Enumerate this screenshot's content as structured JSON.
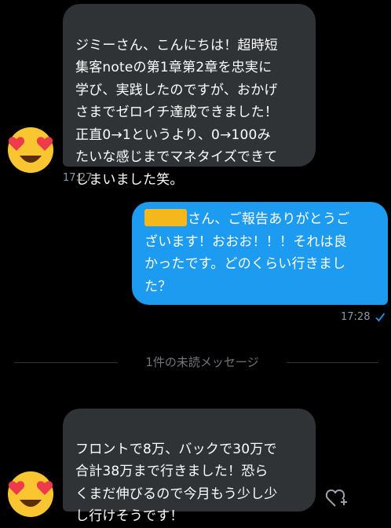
{
  "messages": {
    "m1": {
      "text": "ジミーさん、こんにちは！超時短\n集客noteの第1章第2章を忠実に\n学び、実践したのですが、おかげ\nさまでゼロイチ達成できました！\n正直0→1というより、0→100み\nたいな感じまでマネタイズできて\nしまいました笑。",
      "time": "17:27"
    },
    "m2": {
      "text_after_redaction": "さん、ご報告ありがとうご\nざいます！おおお！！！それは良\nかったです。どのくらい行きまし\nた？",
      "time": "17:28"
    },
    "m3": {
      "text": "フロントで8万、バックで30万で\n合計38万まで行きました！恐ら\nくまだ伸びるので今月もう少し少\nし行けそうです！"
    }
  },
  "divider": {
    "label": "1件の未読メッセージ"
  },
  "icons": {
    "avatar": "heart-eyes-emoji-icon",
    "read_receipt": "check-icon",
    "react": "heart-plus-icon"
  },
  "colors": {
    "incoming_bubble": "#2f3336",
    "outgoing_bubble": "#1d9bf0",
    "redaction": "#f5b81c"
  }
}
